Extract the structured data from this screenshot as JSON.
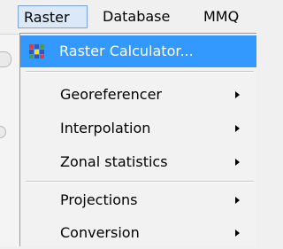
{
  "menubar": {
    "items": [
      {
        "label": "Raster"
      },
      {
        "label": "Database"
      },
      {
        "label": "MMQ"
      }
    ]
  },
  "raster_menu": {
    "items": [
      {
        "label": "Raster Calculator...",
        "icon": "raster-calculator-icon",
        "highlighted": true,
        "has_submenu": false
      },
      {
        "label": "Georeferencer",
        "has_submenu": true
      },
      {
        "label": "Interpolation",
        "has_submenu": true
      },
      {
        "label": "Zonal statistics",
        "has_submenu": true
      },
      {
        "label": "Projections",
        "has_submenu": true
      },
      {
        "label": "Conversion",
        "has_submenu": true
      }
    ]
  },
  "colors": {
    "highlight": "#3399ff",
    "menubar_active_bg": "#dbe8f7",
    "menubar_active_border": "#7aa5d6",
    "menu_bg": "#f2f2f2"
  }
}
